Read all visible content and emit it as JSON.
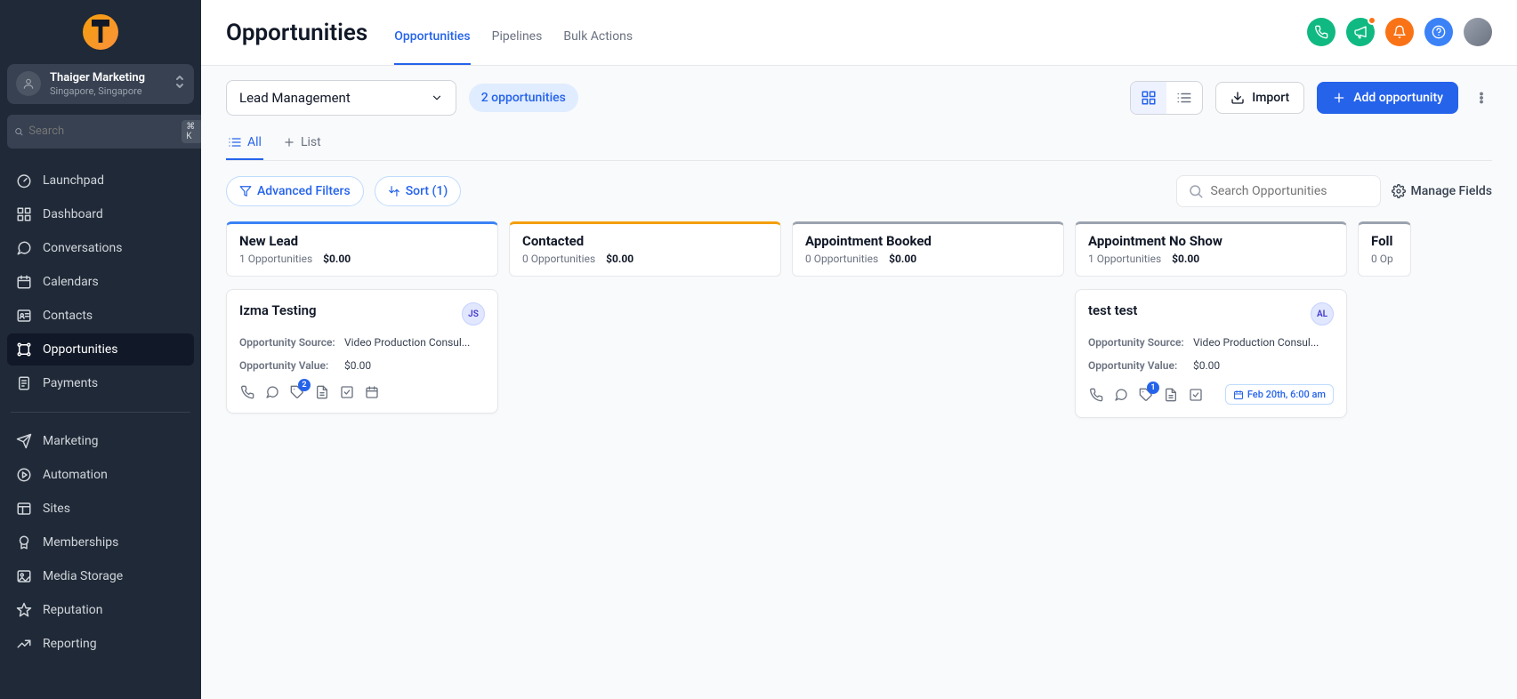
{
  "org": {
    "name": "Thaiger Marketing",
    "location": "Singapore, Singapore"
  },
  "sidebar": {
    "search_placeholder": "Search",
    "search_shortcut": "⌘ K",
    "items": [
      {
        "label": "Launchpad",
        "icon": "gauge-icon"
      },
      {
        "label": "Dashboard",
        "icon": "grid-icon"
      },
      {
        "label": "Conversations",
        "icon": "chat-icon"
      },
      {
        "label": "Calendars",
        "icon": "calendar-icon"
      },
      {
        "label": "Contacts",
        "icon": "id-icon"
      },
      {
        "label": "Opportunities",
        "icon": "opportunities-icon",
        "active": true
      },
      {
        "label": "Payments",
        "icon": "receipt-icon"
      }
    ],
    "items2": [
      {
        "label": "Marketing",
        "icon": "send-icon"
      },
      {
        "label": "Automation",
        "icon": "play-circle-icon"
      },
      {
        "label": "Sites",
        "icon": "layout-icon"
      },
      {
        "label": "Memberships",
        "icon": "badge-icon"
      },
      {
        "label": "Media Storage",
        "icon": "image-icon"
      },
      {
        "label": "Reputation",
        "icon": "star-icon"
      },
      {
        "label": "Reporting",
        "icon": "trend-icon"
      }
    ]
  },
  "header": {
    "title": "Opportunities",
    "tabs": [
      "Opportunities",
      "Pipelines",
      "Bulk Actions"
    ]
  },
  "toolbar": {
    "pipeline": "Lead Management",
    "count_badge": "2 opportunities",
    "import_label": "Import",
    "add_label": "Add opportunity",
    "subtab_all": "All",
    "subtab_list": "List",
    "adv_filters": "Advanced Filters",
    "sort": "Sort (1)",
    "search_placeholder": "Search Opportunities",
    "manage_fields": "Manage Fields"
  },
  "columns": [
    {
      "title": "New Lead",
      "count": "1 Opportunities",
      "value": "$0.00",
      "color": "#3b82f6"
    },
    {
      "title": "Contacted",
      "count": "0 Opportunities",
      "value": "$0.00",
      "color": "#f59e0b"
    },
    {
      "title": "Appointment Booked",
      "count": "0 Opportunities",
      "value": "$0.00",
      "color": "#6b7280"
    },
    {
      "title": "Appointment No Show",
      "count": "1 Opportunities",
      "value": "$0.00",
      "color": "#6b7280"
    },
    {
      "title": "Foll",
      "count": "0 Op",
      "value": "",
      "color": "#6b7280"
    }
  ],
  "cards": {
    "col0": {
      "name": "Izma Testing",
      "avatar": "JS",
      "source_label": "Opportunity Source:",
      "source": "Video Production Consul...",
      "value_label": "Opportunity Value:",
      "value": "$0.00",
      "tag_badge": "2"
    },
    "col3": {
      "name": "test test",
      "avatar": "AL",
      "source_label": "Opportunity Source:",
      "source": "Video Production Consul...",
      "value_label": "Opportunity Value:",
      "value": "$0.00",
      "tag_badge": "1",
      "date": "Feb 20th, 6:00 am"
    }
  }
}
